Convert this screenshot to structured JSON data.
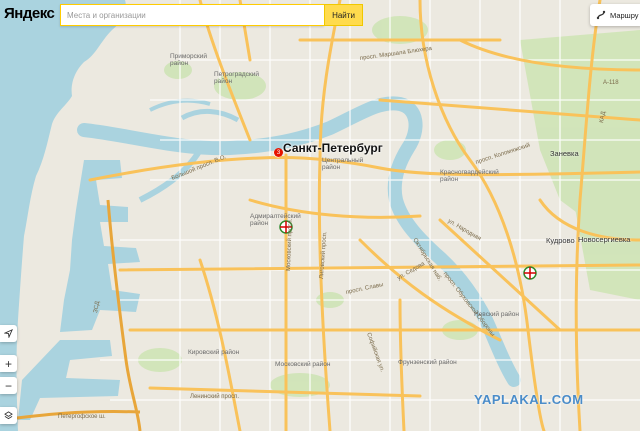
{
  "header": {
    "logo": "Яндекс",
    "search_placeholder": "Места и организации",
    "search_button": "Найти",
    "route_button": "Маршру"
  },
  "controls": {
    "locate": "locate-icon",
    "zoom_in": "+",
    "zoom_out": "−",
    "layers": "layers-icon"
  },
  "map": {
    "city": "Санкт-Петербург",
    "towns": {
      "zanevka": "Заневка",
      "kudrovo": "Кудрово",
      "novosaratovka": "Новосергиевка"
    },
    "districts": {
      "primorsky": "Приморский\nрайон",
      "petrogradsky": "Петроградский\nрайон",
      "central": "Центральный\nрайон",
      "admiralteysky": "Адмиралтейский\nрайон",
      "nevsky": "Невский район",
      "krasnogvardeysky": "Красногвардейский\nрайон",
      "kirovsky": "Кировский район",
      "frunzensky": "Фрунзенский район",
      "moskovsky": "Московский район"
    },
    "streets": {
      "bolshoy_vo": "Большой просп. В.О.",
      "marshala_blyukhera": "просп. Маршала Блюхера",
      "kad": "КАД",
      "kad_num": "А-118",
      "kolomyazhsky": "просп. Коломяжский",
      "obukhovskoy": "просп. Обуховской Обороны",
      "oktyabrskaya": "Октябрьская наб.",
      "moskovsky": "Московский просп.",
      "ligovsky": "Лиговский просп.",
      "leninsky": "Ленинский просп.",
      "petergofskoe": "Петергофское ш.",
      "narodnaya": "ул. Народная",
      "sofiyskaya": "Софийская ул.",
      "slavy": "просп. Славы",
      "sedova": "ул. Седова",
      "zsd": "ЗСД"
    },
    "metro_badge": "3"
  },
  "watermark": "YAPLAKAL.COM",
  "colors": {
    "water": "#aad3df",
    "land": "#ece9e0",
    "major_road": "#f9c25a",
    "minor_road": "#ffffff",
    "park": "#cfe4b6",
    "brand_red": "#e61400",
    "search_yellow": "#ffdb4d"
  }
}
